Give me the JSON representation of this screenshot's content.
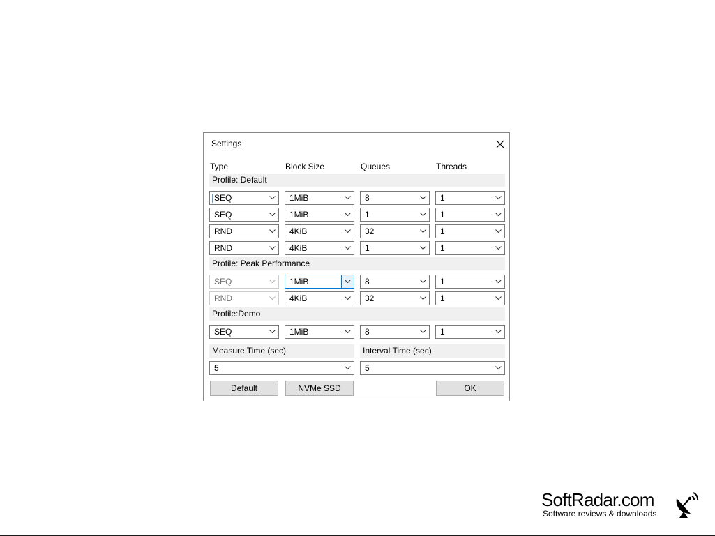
{
  "dialog": {
    "title": "Settings"
  },
  "columns": {
    "type": "Type",
    "block_size": "Block Size",
    "queues": "Queues",
    "threads": "Threads"
  },
  "profiles": {
    "default": {
      "label": "Profile: Default",
      "rows": [
        {
          "type": "SEQ",
          "block": "1MiB",
          "queues": "8",
          "threads": "1"
        },
        {
          "type": "SEQ",
          "block": "1MiB",
          "queues": "1",
          "threads": "1"
        },
        {
          "type": "RND",
          "block": "4KiB",
          "queues": "32",
          "threads": "1"
        },
        {
          "type": "RND",
          "block": "4KiB",
          "queues": "1",
          "threads": "1"
        }
      ]
    },
    "peak": {
      "label": "Profile: Peak Performance",
      "rows": [
        {
          "type": "SEQ",
          "block": "1MiB",
          "queues": "8",
          "threads": "1"
        },
        {
          "type": "RND",
          "block": "4KiB",
          "queues": "32",
          "threads": "1"
        }
      ]
    },
    "demo": {
      "label": "Profile:Demo",
      "rows": [
        {
          "type": "SEQ",
          "block": "1MiB",
          "queues": "8",
          "threads": "1"
        }
      ]
    }
  },
  "timing": {
    "measure_label": "Measure Time (sec)",
    "measure_value": "5",
    "interval_label": "Interval Time (sec)",
    "interval_value": "5"
  },
  "buttons": {
    "default": "Default",
    "nvme": "NVMe SSD",
    "ok": "OK"
  },
  "watermark": {
    "name": "SoftRadar.com",
    "tagline": "Software reviews & downloads"
  },
  "icons": {
    "close": "close-icon",
    "dropdown": "chevron-down-icon",
    "logo": "satellite-dish-icon"
  }
}
